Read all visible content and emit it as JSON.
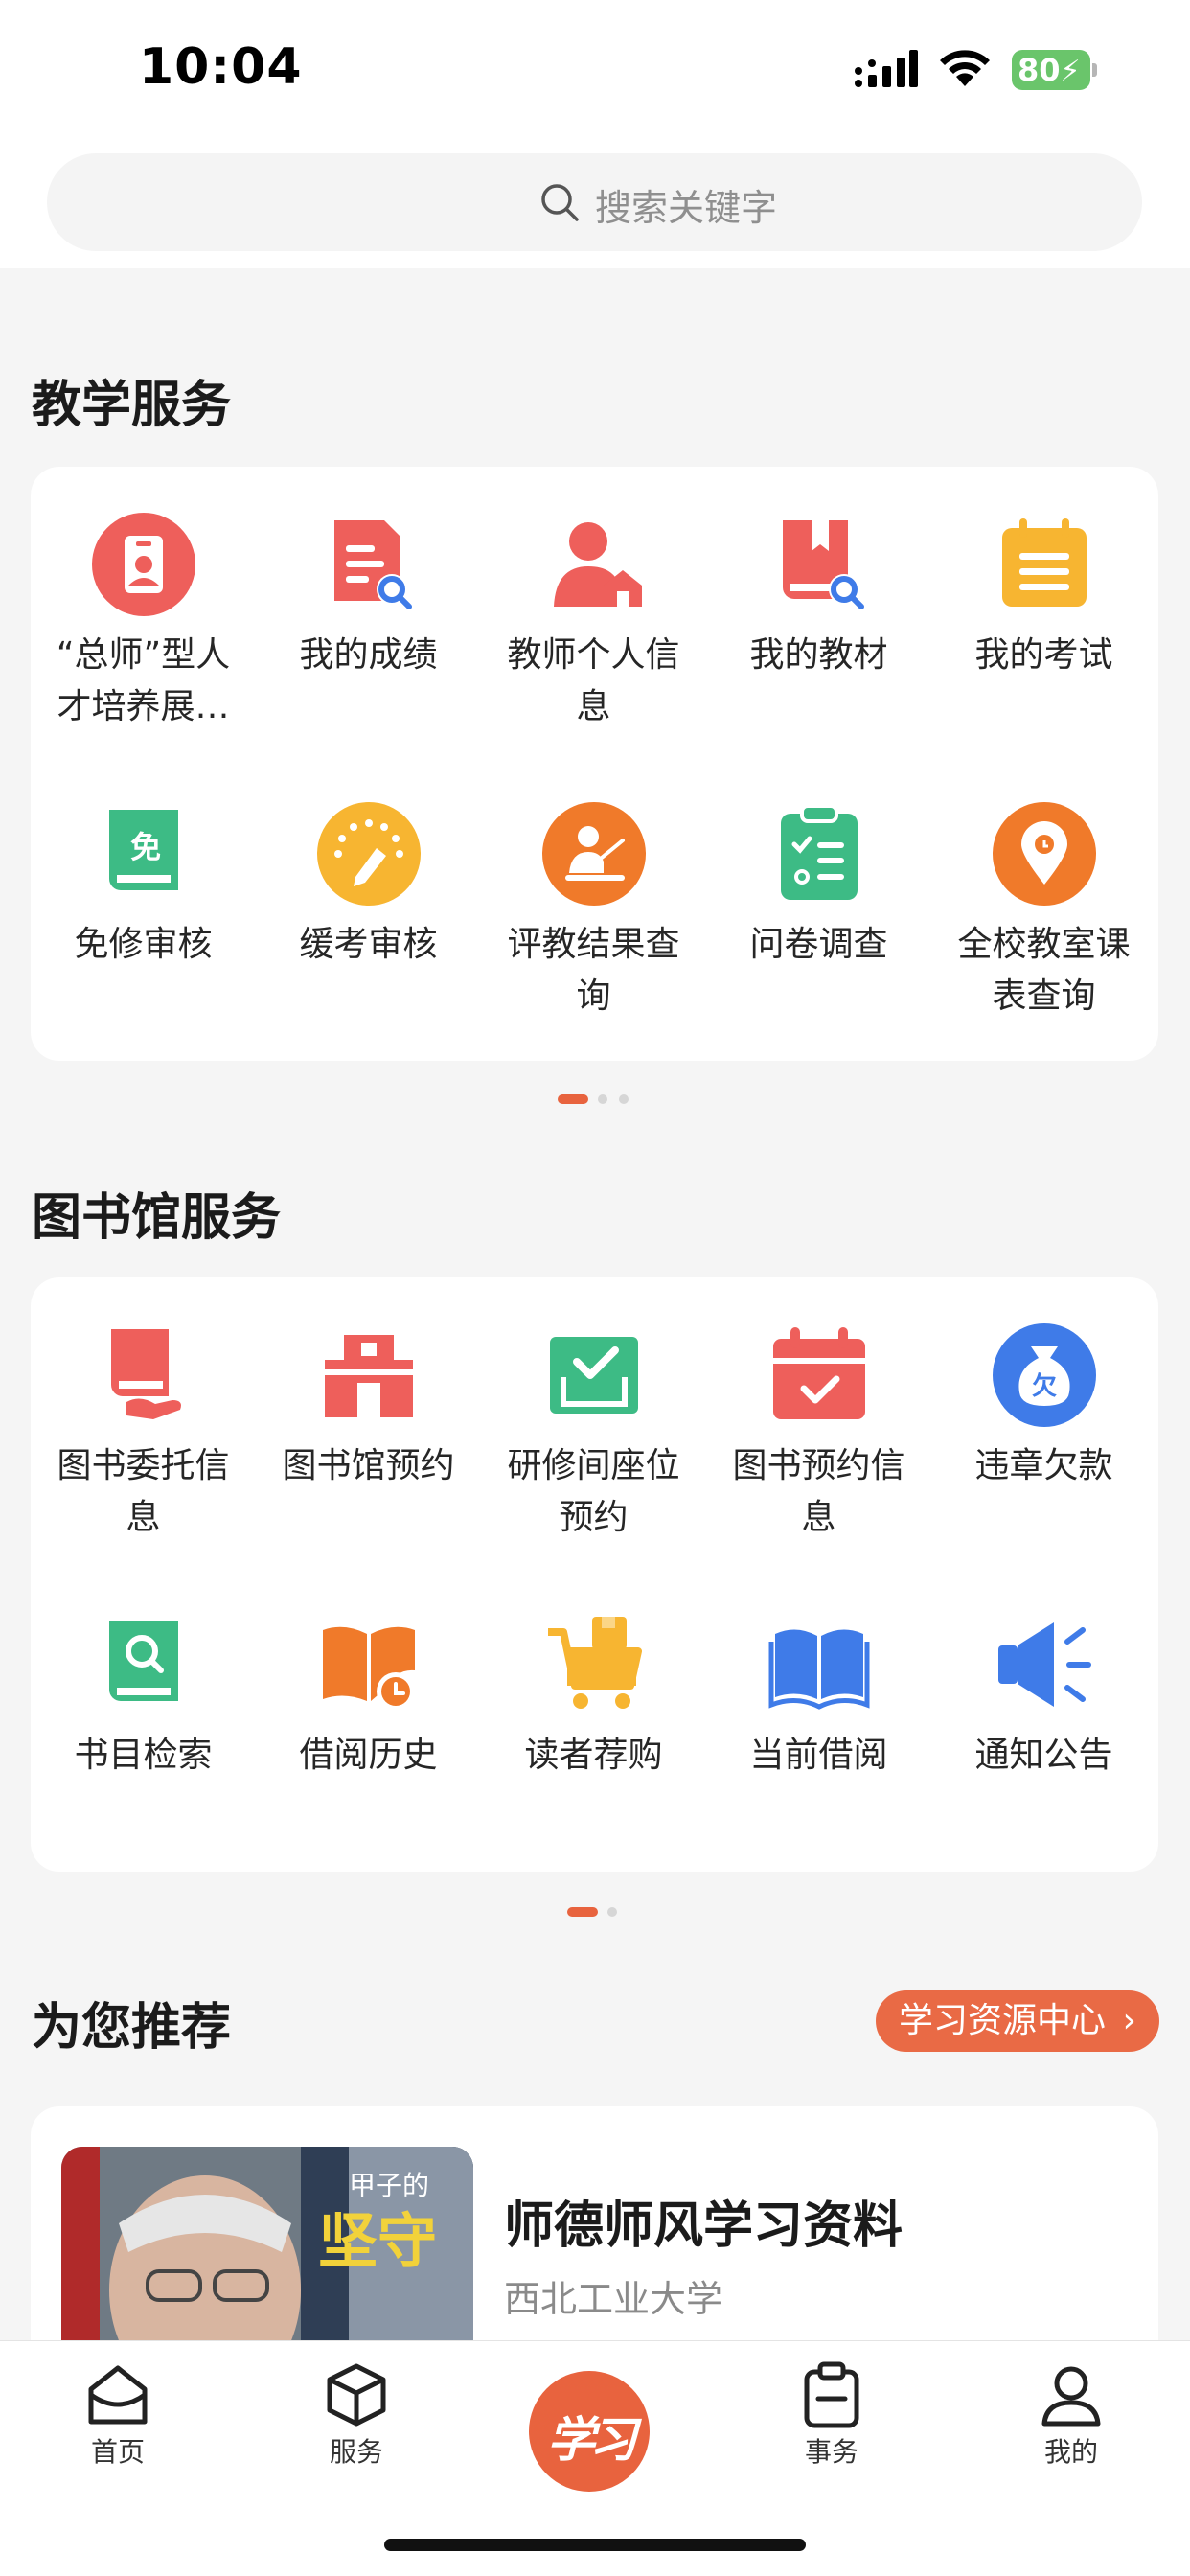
{
  "status_bar": {
    "time": "10:04",
    "battery": "80"
  },
  "search": {
    "placeholder": "搜索关键字"
  },
  "teaching": {
    "title": "教学服务",
    "items": [
      {
        "label": "“总师”型人\n才培养展…",
        "icon": "id-badge-icon"
      },
      {
        "label": "我的成绩",
        "icon": "grade-search-icon"
      },
      {
        "label": "教师个人信\n息",
        "icon": "teacher-profile-icon"
      },
      {
        "label": "我的教材",
        "icon": "book-search-icon"
      },
      {
        "label": "我的考试",
        "icon": "exam-calendar-icon"
      },
      {
        "label": "免修审核",
        "icon": "exempt-book-icon"
      },
      {
        "label": "缓考审核",
        "icon": "deferred-exam-icon"
      },
      {
        "label": "评教结果查\n询",
        "icon": "evaluation-icon"
      },
      {
        "label": "问卷调查",
        "icon": "survey-clipboard-icon"
      },
      {
        "label": "全校教室课\n表查询",
        "icon": "location-pin-icon"
      }
    ],
    "colors": {
      "red": "#ee5f5b",
      "orange": "#f07a2a",
      "yellow": "#f7b531",
      "green": "#3dbb85"
    }
  },
  "library": {
    "title": "图书馆服务",
    "items": [
      {
        "label": "图书委托信\n息",
        "icon": "book-hand-icon"
      },
      {
        "label": "图书馆预约",
        "icon": "library-building-icon"
      },
      {
        "label": "研修间座位\n预约",
        "icon": "seat-check-icon"
      },
      {
        "label": "图书预约信\n息",
        "icon": "calendar-check-icon"
      },
      {
        "label": "违章欠款",
        "icon": "money-bag-icon"
      },
      {
        "label": "书目检索",
        "icon": "catalog-search-icon"
      },
      {
        "label": "借阅历史",
        "icon": "borrow-history-icon"
      },
      {
        "label": "读者荐购",
        "icon": "shopping-cart-icon"
      },
      {
        "label": "当前借阅",
        "icon": "open-book-icon"
      },
      {
        "label": "通知公告",
        "icon": "megaphone-icon"
      }
    ]
  },
  "recommend": {
    "title": "为您推荐",
    "button": "学习资源中心",
    "card": {
      "title": "师德师风学习资料",
      "subtitle": "西北工业大学",
      "thumb_text": "坚守",
      "thumb_text2": "甲子的"
    }
  },
  "tabbar": {
    "items": [
      {
        "label": "首页",
        "icon": "home-icon"
      },
      {
        "label": "服务",
        "icon": "cube-icon"
      },
      {
        "label": "学习",
        "icon": "study-logo-icon"
      },
      {
        "label": "事务",
        "icon": "clipboard-icon"
      },
      {
        "label": "我的",
        "icon": "user-icon"
      }
    ],
    "center_label": "学习"
  },
  "accent": "#e8633e"
}
